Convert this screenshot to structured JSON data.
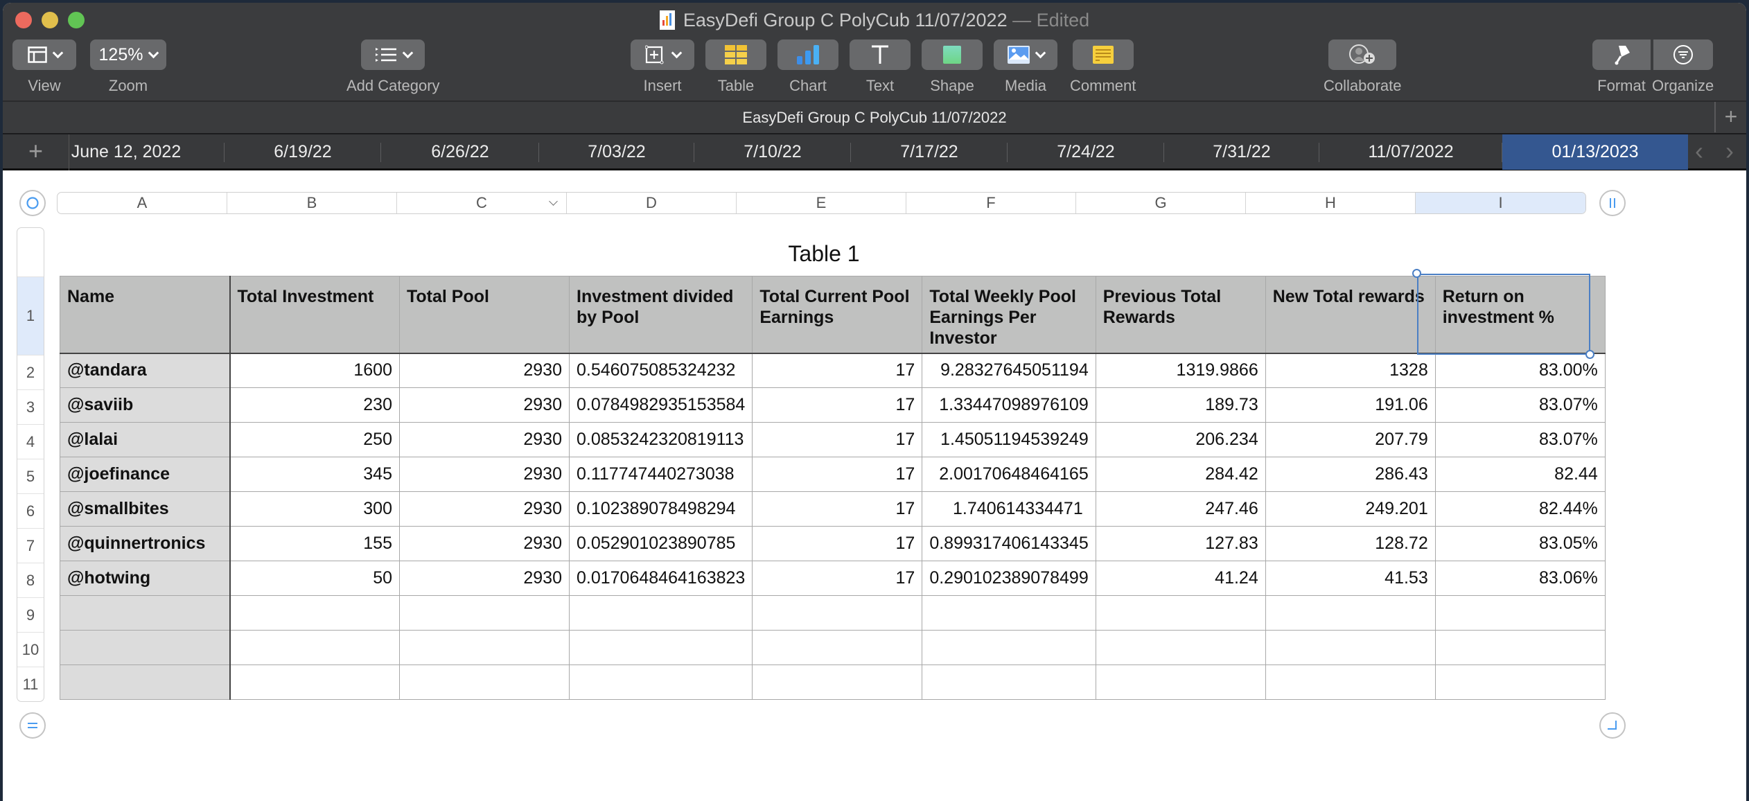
{
  "window": {
    "title": "EasyDefi Group C PolyCub 11/07/2022",
    "edited_suffix": "— Edited"
  },
  "toolbar": {
    "view": "View",
    "zoom_value": "125%",
    "zoom": "Zoom",
    "add_category": "Add Category",
    "insert": "Insert",
    "table": "Table",
    "chart": "Chart",
    "text": "Text",
    "shape": "Shape",
    "media": "Media",
    "comment": "Comment",
    "collaborate": "Collaborate",
    "format": "Format",
    "organize": "Organize"
  },
  "sheet_bar_title": "EasyDefi Group C PolyCub 11/07/2022",
  "sheet_tabs": [
    {
      "label": "June 12, 2022",
      "active": false
    },
    {
      "label": "6/19/22",
      "active": false
    },
    {
      "label": "6/26/22",
      "active": false
    },
    {
      "label": "7/03/22",
      "active": false
    },
    {
      "label": "7/10/22",
      "active": false
    },
    {
      "label": "7/17/22",
      "active": false
    },
    {
      "label": "7/24/22",
      "active": false
    },
    {
      "label": "7/31/22",
      "active": false
    },
    {
      "label": "11/07/2022",
      "active": false
    },
    {
      "label": "01/13/2023",
      "active": true
    }
  ],
  "accent_color": "#345790",
  "column_refs": [
    "A",
    "B",
    "C",
    "D",
    "E",
    "F",
    "G",
    "H",
    "I"
  ],
  "selected_column": "I",
  "row_numbers": [
    "1",
    "2",
    "3",
    "4",
    "5",
    "6",
    "7",
    "8",
    "9",
    "10",
    "11"
  ],
  "table": {
    "title": "Table 1",
    "headers": [
      "Name",
      "Total Investment",
      "Total Pool",
      "Investment divided by Pool",
      "Total Current Pool Earnings",
      "Total Weekly Pool Earnings Per Investor",
      "Previous Total Rewards",
      "New Total rewards",
      "Return on investment %"
    ],
    "rows": [
      [
        "@tandara",
        "1600",
        "2930",
        "0.546075085324232",
        "17",
        "9.28327645051194",
        "1319.9866",
        "1328",
        "83.00%"
      ],
      [
        "@saviib",
        "230",
        "2930",
        "0.0784982935153584",
        "17",
        "1.33447098976109",
        "189.73",
        "191.06",
        "83.07%"
      ],
      [
        "@lalai",
        "250",
        "2930",
        "0.0853242320819113",
        "17",
        "1.45051194539249",
        "206.234",
        "207.79",
        "83.07%"
      ],
      [
        "@joefinance",
        "345",
        "2930",
        "0.117747440273038",
        "17",
        "2.00170648464165",
        "284.42",
        "286.43",
        "82.44"
      ],
      [
        "@smallbites",
        "300",
        "2930",
        "0.102389078498294",
        "17",
        "1.740614334471",
        "247.46",
        "249.201",
        "82.44%"
      ],
      [
        "@quinnertronics",
        "155",
        "2930",
        "0.052901023890785",
        "17",
        "0.899317406143345",
        "127.83",
        "128.72",
        "83.05%"
      ],
      [
        "@hotwing",
        "50",
        "2930",
        "0.0170648464163823",
        "17",
        "0.290102389078499",
        "41.24",
        "41.53",
        "83.06%"
      ],
      [
        "",
        "",
        "",
        "",
        "",
        "",
        "",
        "",
        ""
      ],
      [
        "",
        "",
        "",
        "",
        "",
        "",
        "",
        "",
        ""
      ],
      [
        "",
        "",
        "",
        "",
        "",
        "",
        "",
        "",
        ""
      ]
    ]
  }
}
